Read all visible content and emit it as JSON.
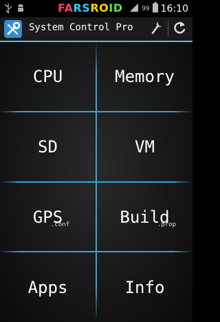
{
  "status_bar": {
    "logo_parts": [
      "FA",
      "RS",
      "RO",
      "ID"
    ],
    "battery_percent": "99",
    "time": "16:10",
    "icons": [
      "usb-icon",
      "android-icon",
      "signal-icon",
      "battery-icon"
    ]
  },
  "action_bar": {
    "title": "System Control Pro",
    "icons": [
      "app-tools-icon",
      "wrench-icon",
      "refresh-icon"
    ],
    "accent_color": "#4fc3f7"
  },
  "menu": {
    "tiles": [
      {
        "label": "CPU",
        "sub": ""
      },
      {
        "label": "Memory",
        "sub": ""
      },
      {
        "label": "SD",
        "sub": ""
      },
      {
        "label": "VM",
        "sub": ""
      },
      {
        "label": "GPS",
        "sub": ".conf"
      },
      {
        "label": "Build",
        "sub": ".prop"
      },
      {
        "label": "Apps",
        "sub": ""
      },
      {
        "label": "Info",
        "sub": ""
      }
    ]
  }
}
